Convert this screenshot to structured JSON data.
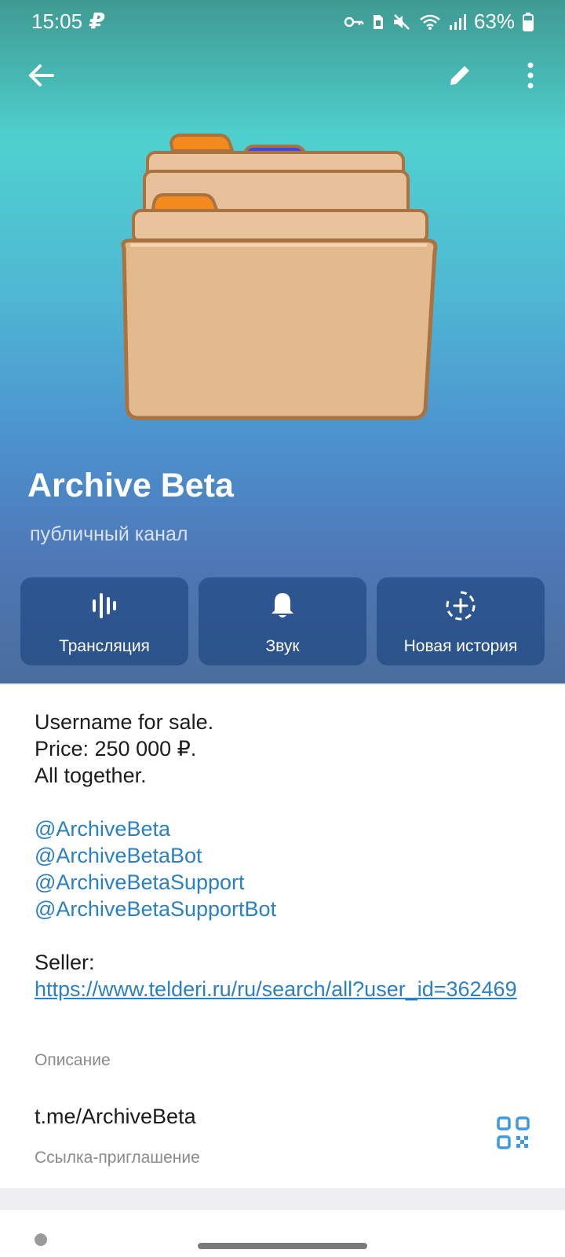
{
  "status_bar": {
    "time": "15:05",
    "p_icon": "₽",
    "battery": "63%",
    "icons": [
      "key-icon",
      "sim-icon",
      "mute-icon",
      "wifi-icon",
      "signal-icon",
      "battery-icon"
    ]
  },
  "topbar": {
    "back_icon": "arrow-left-icon",
    "edit_icon": "pencil-icon",
    "more_icon": "more-vertical-icon"
  },
  "channel": {
    "name": "Archive Beta",
    "subtitle": "публичный канал",
    "avatar_icon": "card-index-dividers-icon"
  },
  "actions": [
    {
      "label": "Трансляция",
      "icon": "live-stream-icon"
    },
    {
      "label": "Звук",
      "icon": "bell-icon"
    },
    {
      "label": "Новая история",
      "icon": "add-story-icon"
    }
  ],
  "description": {
    "line1": "Username for sale.",
    "line2": "Price: 250 000 ₽.",
    "line3": "All together.",
    "mentions": [
      "@ArchiveBeta",
      "@ArchiveBetaBot",
      "@ArchiveBetaSupport",
      "@ArchiveBetaSupportBot"
    ],
    "seller_label": "Seller:",
    "seller_link": "https://www.telderi.ru/ru/search/all?user_id=362469",
    "caption": "Описание"
  },
  "invite": {
    "link": "t.me/ArchiveBeta",
    "caption": "Ссылка-приглашение",
    "qr_icon": "qr-code-icon"
  },
  "colors": {
    "accent": "#2a80c0",
    "header_top": "#4fd1cf",
    "header_bottom": "#4a6d9c",
    "action_bg": "#1e4f8a"
  }
}
